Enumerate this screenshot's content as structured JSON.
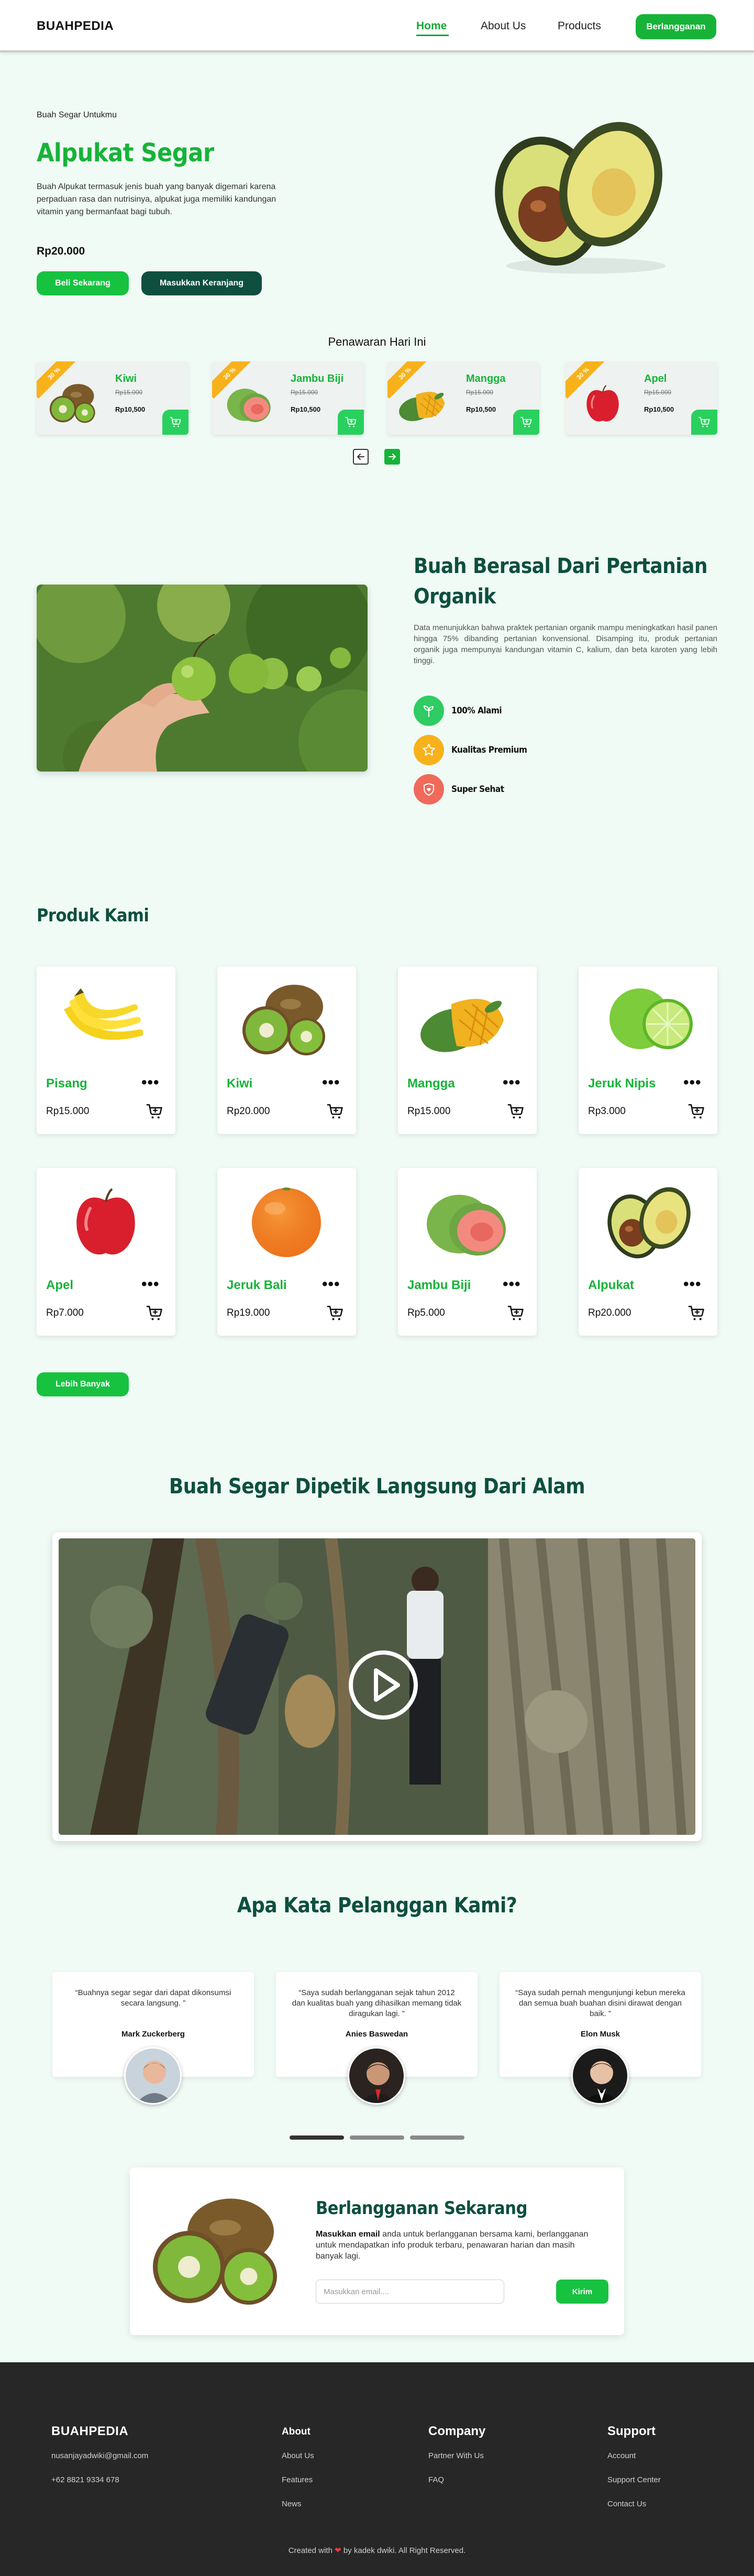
{
  "navbar": {
    "logo": "BUAHPEDIA",
    "links": [
      "Home",
      "About Us",
      "Products"
    ],
    "subscribe_label": "Berlangganan"
  },
  "hero": {
    "eyebrow": "Buah Segar Untukmu",
    "title": "Alpukat Segar",
    "description": "Buah Alpukat termasuk jenis buah yang banyak digemari karena perpaduan rasa dan nutrisinya, alpukat juga memiliki kandungan vitamin yang bermanfaat bagi tubuh.",
    "price": "Rp20.000",
    "buy_label": "Beli Sekarang",
    "cart_label": "Masukkan Keranjang"
  },
  "offers": {
    "title": "Penawaran Hari Ini",
    "items": [
      {
        "badge": "30 %",
        "name": "Kiwi",
        "old_price": "Rp15.000",
        "new_price": "Rp10,500"
      },
      {
        "badge": "30 %",
        "name": "Jambu Biji",
        "old_price": "Rp15.000",
        "new_price": "Rp10,500"
      },
      {
        "badge": "30 %",
        "name": "Mangga",
        "old_price": "Rp15.000",
        "new_price": "Rp10,500"
      },
      {
        "badge": "30 %",
        "name": "Apel",
        "old_price": "Rp15.000",
        "new_price": "Rp10,500"
      }
    ]
  },
  "organic": {
    "title": "Buah Berasal Dari Pertanian Organik",
    "description": "Data menunjukkan bahwa praktek pertanian organik mampu meningkatkan hasil panen hingga 75% dibanding pertanian konvensional. Disamping itu, produk pertanian organik juga mempunyai kandungan vitamin C, kalium, dan beta karoten yang lebih tinggi.",
    "features": [
      "100% Alami",
      "Kualitas Premium",
      "Super Sehat"
    ]
  },
  "products": {
    "title": "Produk Kami",
    "items": [
      {
        "name": "Pisang",
        "price": "Rp15.000"
      },
      {
        "name": "Kiwi",
        "price": "Rp20.000"
      },
      {
        "name": "Mangga",
        "price": "Rp15.000"
      },
      {
        "name": "Jeruk Nipis",
        "price": "Rp3.000"
      },
      {
        "name": "Apel",
        "price": "Rp7.000"
      },
      {
        "name": "Jeruk Bali",
        "price": "Rp19.000"
      },
      {
        "name": "Jambu Biji",
        "price": "Rp5.000"
      },
      {
        "name": "Alpukat",
        "price": "Rp20.000"
      }
    ],
    "more_label": "Lebih Banyak"
  },
  "video": {
    "title": "Buah Segar Dipetik Langsung Dari Alam"
  },
  "testimonials": {
    "title": "Apa Kata Pelanggan Kami?",
    "items": [
      {
        "quote": "“Buahnya segar segar dari dapat dikonsumsi secara langsung. ”",
        "name": "Mark Zuckerberg"
      },
      {
        "quote": "“Saya sudah berlangganan sejak tahun 2012 dan kualitas buah yang dihasilkan memang tidak diragukan lagi. ”",
        "name": "Anies Baswedan"
      },
      {
        "quote": "“Saya sudah pernah mengunjungi kebun mereka dan semua buah buahan disini dirawat dengan baik. ”",
        "name": "Elon Musk"
      }
    ]
  },
  "subscribe": {
    "title": "Berlangganan Sekarang",
    "desc_bold": "Masukkan email",
    "desc_rest": " anda untuk berlangganan bersama kami, berlangganan untuk mendapatkan info produk terbaru, penawaran harian dan masih banyak lagi.",
    "email_placeholder": "Masukkan email....",
    "send_label": "Kirim"
  },
  "footer": {
    "brand": "BUAHPEDIA",
    "email": "nusanjayadwiki@gmail.com",
    "phone": "+62 8821 9334 678",
    "about_head": "About",
    "about_links": [
      "About Us",
      "Features",
      "News"
    ],
    "company_head": "Company",
    "company_links": [
      "Partner With Us",
      "FAQ"
    ],
    "support_head": "Support",
    "support_links": [
      "Account",
      "Support Center",
      "Contact Us"
    ],
    "copyright_pre": "Created with ",
    "copyright_post": " by kadek dwiki. All Right Reserved."
  },
  "colors": {
    "brand_green": "#17b338",
    "dark_green": "#0e4f3f",
    "badge_orange": "#f7b21b",
    "page_bg": "#f0fbf5",
    "footer_bg": "#272727"
  }
}
